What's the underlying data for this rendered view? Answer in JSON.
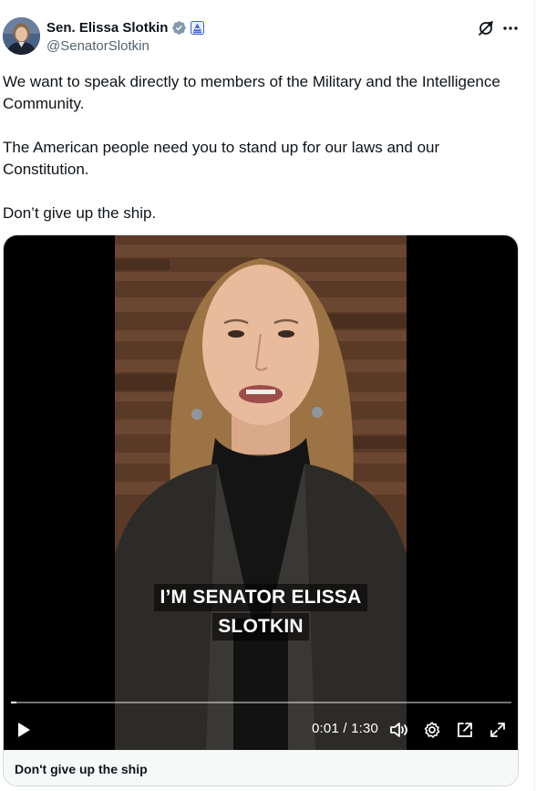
{
  "author": {
    "display_name": "Sen. Elissa Slotkin",
    "handle": "@SenatorSlotkin",
    "verified_icon": "gray-verified-badge-icon",
    "affiliation_icon": "government-affiliation-badge-icon"
  },
  "header_icons": {
    "grok": "grok-icon",
    "more": "more-icon"
  },
  "tweet": {
    "paragraphs": [
      "We want to speak directly to members of the Military and the Intelligence Community.",
      "The American people need you to stand up for our laws and our Constitution.",
      "Don’t give up the ship."
    ]
  },
  "video": {
    "caption_line1": "I’M SENATOR ELISSA",
    "caption_line2": "SLOTKIN",
    "time": "0:01 / 1:30",
    "progress_fraction": 0.011,
    "card_title": "Don't give up the ship"
  },
  "colors": {
    "text_primary": "#0f1419",
    "text_secondary": "#536471",
    "verified_gray": "#829aab",
    "affiliation_blue": "#1d9bf0"
  }
}
